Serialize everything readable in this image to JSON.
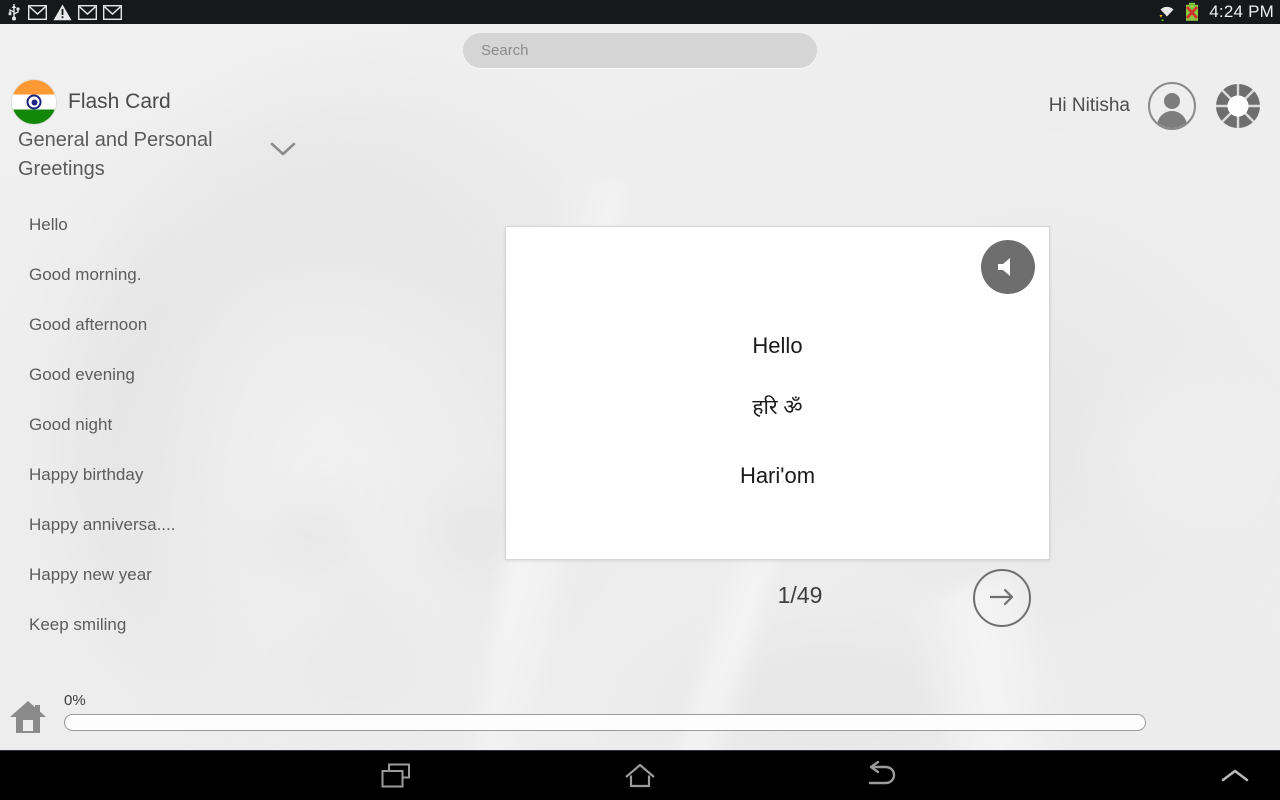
{
  "statusbar": {
    "time": "4:24 PM",
    "left_icons": [
      "usb-icon",
      "mail-icon",
      "warning-icon",
      "mail-icon",
      "mail-icon"
    ],
    "right_icons": [
      "wifi-icon",
      "battery-error-icon"
    ]
  },
  "search": {
    "placeholder": "Search",
    "value": ""
  },
  "header": {
    "logo": "india-flag-icon",
    "app_title": "Flash Card",
    "deck_name": "General and Personal Greetings",
    "deck_chevron": "chevron-down-icon",
    "greeting": "Hi Nitisha",
    "avatar_icon": "user-avatar-icon",
    "settings_icon": "settings-ring-icon"
  },
  "sidebar": {
    "items": [
      {
        "label": "Hello"
      },
      {
        "label": "Good morning."
      },
      {
        "label": "Good afternoon"
      },
      {
        "label": "Good evening"
      },
      {
        "label": "Good night"
      },
      {
        "label": "Happy birthday"
      },
      {
        "label": "Happy anniversa...."
      },
      {
        "label": "Happy new year"
      },
      {
        "label": "Keep smiling"
      }
    ]
  },
  "card": {
    "term": "Hello",
    "native": "हरि ॐ",
    "transliteration": "Hari'om",
    "speaker_icon": "speaker-icon"
  },
  "navigation": {
    "counter": "1/49",
    "next_icon": "arrow-right-icon"
  },
  "footer": {
    "home_icon": "home-icon",
    "progress_label": "0%",
    "progress_value": 0
  },
  "navbar": {
    "recents": "recents-icon",
    "home": "home-outline-icon",
    "back": "back-arrow-icon",
    "hide": "chevron-up-icon"
  },
  "colors": {
    "accent_saffron": "#ff9933",
    "accent_green": "#138808",
    "chakra_navy": "#1a237e",
    "speaker_bg": "#6e6e6e",
    "page_bg": "#e6e6e6",
    "statusbar_bg": "#16191a"
  }
}
